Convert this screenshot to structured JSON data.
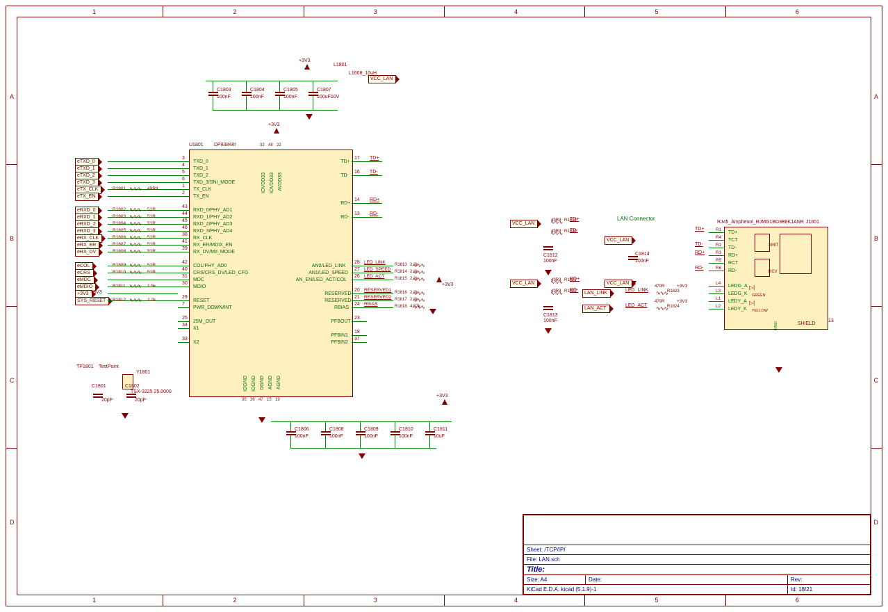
{
  "ic": {
    "ref": "U1801",
    "value": "DP83848I",
    "pins_left": [
      {
        "num": "3",
        "name": "TXD_0"
      },
      {
        "num": "4",
        "name": "TXD_1"
      },
      {
        "num": "5",
        "name": "TXD_2"
      },
      {
        "num": "6",
        "name": "TXD_3/SNI_MODE"
      },
      {
        "num": "1",
        "name": "TX_CLK"
      },
      {
        "num": "2",
        "name": "TX_EN"
      },
      {
        "num": "",
        "name": ""
      },
      {
        "num": "43",
        "name": "RXD_0/PHY_AD1"
      },
      {
        "num": "44",
        "name": "RXD_1/PHY_AD2"
      },
      {
        "num": "45",
        "name": "RXD_2/PHY_AD3"
      },
      {
        "num": "46",
        "name": "RXD_3/PHY_AD4"
      },
      {
        "num": "38",
        "name": "RX_CLK"
      },
      {
        "num": "41",
        "name": "RX_ER/MDIX_EN"
      },
      {
        "num": "39",
        "name": "RX_DV/MII_MODE"
      },
      {
        "num": "",
        "name": ""
      },
      {
        "num": "42",
        "name": "COL/PHY_AD0"
      },
      {
        "num": "40",
        "name": "CRS/CRS_DV/LED_CFG"
      },
      {
        "num": "31",
        "name": "MDC"
      },
      {
        "num": "30",
        "name": "MDIO"
      },
      {
        "num": "",
        "name": ""
      },
      {
        "num": "29",
        "name": "RESET"
      },
      {
        "num": "7",
        "name": "PWR_DOWN/INT"
      },
      {
        "num": "",
        "name": ""
      },
      {
        "num": "25",
        "name": "25M_OUT"
      },
      {
        "num": "34",
        "name": "X1"
      },
      {
        "num": "",
        "name": ""
      },
      {
        "num": "33",
        "name": "X2"
      }
    ],
    "pins_right": [
      {
        "num": "17",
        "name": "TD+"
      },
      {
        "num": "",
        "name": ""
      },
      {
        "num": "16",
        "name": "TD-"
      },
      {
        "num": "",
        "name": ""
      },
      {
        "num": "",
        "name": ""
      },
      {
        "num": "",
        "name": ""
      },
      {
        "num": "14",
        "name": "RD+"
      },
      {
        "num": "",
        "name": ""
      },
      {
        "num": "13",
        "name": "RD-"
      },
      {
        "num": "",
        "name": ""
      },
      {
        "num": "",
        "name": ""
      },
      {
        "num": "",
        "name": ""
      },
      {
        "num": "",
        "name": ""
      },
      {
        "num": "",
        "name": ""
      },
      {
        "num": "",
        "name": ""
      },
      {
        "num": "28",
        "name": "AN0/LED_LINK"
      },
      {
        "num": "27",
        "name": "AN1/LED_SPEED"
      },
      {
        "num": "26",
        "name": "AN_EN/LED_ACT/COL"
      },
      {
        "num": "",
        "name": ""
      },
      {
        "num": "20",
        "name": "RESERVED"
      },
      {
        "num": "21",
        "name": "RESERVED"
      },
      {
        "num": "24",
        "name": "RBIAS"
      },
      {
        "num": "",
        "name": ""
      },
      {
        "num": "23",
        "name": "PFBOUT"
      },
      {
        "num": "",
        "name": ""
      },
      {
        "num": "18",
        "name": "PFBIN1"
      },
      {
        "num": "37",
        "name": "PFBIN2"
      }
    ],
    "pins_top": [
      "IOVDD33",
      "IOVDD33",
      "AVDD33"
    ],
    "pins_top_num": [
      "32",
      "48",
      "22"
    ],
    "pins_bot": [
      "IOGND",
      "IOGND",
      "DGND",
      "AGND",
      "AGND"
    ],
    "pins_bot_num": [
      "35",
      "36",
      "47",
      "15",
      "19"
    ]
  },
  "ports_left": [
    "eTXD_0",
    "eTXD_1",
    "eTXD_2",
    "eTXD_3",
    "eTX_CLK",
    "eTX_EN",
    "",
    "eRXD_0",
    "eRXD_1",
    "eRXD_2",
    "eRXD_3",
    "eRX_CLK",
    "eRX_ER",
    "eRX_DV",
    "",
    "eCOL",
    "eCRS",
    "eMDC",
    "eMDIO",
    "+3V3",
    "SYS_RESET"
  ],
  "series_res_left": [
    {
      "ref": "R1801",
      "val": "49R9"
    },
    {
      "ref": "R1802",
      "val": "51R"
    },
    {
      "ref": "R1803",
      "val": "51R"
    },
    {
      "ref": "R1804",
      "val": "51R"
    },
    {
      "ref": "R1805",
      "val": "51R"
    },
    {
      "ref": "R1806",
      "val": "51R"
    },
    {
      "ref": "R1807",
      "val": "51R"
    },
    {
      "ref": "R1808",
      "val": "51R"
    },
    {
      "ref": "R1809",
      "val": "51R"
    },
    {
      "ref": "R1810",
      "val": "51R"
    },
    {
      "ref": "R1811",
      "val": "1.5k"
    },
    {
      "ref": "R1812",
      "val": "2.2k"
    }
  ],
  "top_caps": [
    {
      "ref": "C1803",
      "val": "100nF"
    },
    {
      "ref": "C1804",
      "val": "100nF"
    },
    {
      "ref": "C1805",
      "val": "100nF"
    },
    {
      "ref": "C1807",
      "val": "100uF10V"
    }
  ],
  "inductor": {
    "ref": "L1801",
    "val": "L1608_10uH"
  },
  "power_labels": {
    "v33": "+3V3",
    "vcc": "VCC_LAN"
  },
  "xtal": {
    "ref": "Y1801",
    "val": "TSX-3225 25.0000"
  },
  "testpoint": {
    "ref": "TP1801",
    "val": "TestPoint"
  },
  "xtal_caps": [
    {
      "ref": "C1801",
      "val": "20pF"
    },
    {
      "ref": "C1802",
      "val": "20pF"
    }
  ],
  "bot_caps": [
    {
      "ref": "C1806",
      "val": "100nF"
    },
    {
      "ref": "C1808",
      "val": "100nF"
    },
    {
      "ref": "C1809",
      "val": "100nF"
    },
    {
      "ref": "C1810",
      "val": "100nF"
    },
    {
      "ref": "C1811",
      "val": "10uF"
    }
  ],
  "led_nets": [
    "LED_LINK",
    "LED_SPEED",
    "LED_ACT",
    "RESERVED1",
    "RESERVED2",
    "RBIAS"
  ],
  "led_res": [
    {
      "ref": "R1813",
      "val": "2.2k"
    },
    {
      "ref": "R1814",
      "val": "2.2k"
    },
    {
      "ref": "R1815",
      "val": "2.2k"
    },
    {
      "ref": "R1816",
      "val": "2.2k"
    },
    {
      "ref": "R1817",
      "val": "2.2k"
    },
    {
      "ref": "R1818",
      "val": "4.87k"
    }
  ],
  "td_nets": [
    "TD+",
    "TD-",
    "RD+",
    "RD-"
  ],
  "mid_block": {
    "td_res": [
      {
        "ref": "R1819",
        "val": "49R9"
      },
      {
        "ref": "R1820",
        "val": "49R9"
      },
      {
        "ref": "R1821",
        "val": "49R9"
      },
      {
        "ref": "R1822",
        "val": "49R9"
      }
    ],
    "caps": [
      {
        "ref": "C1812",
        "val": "100nF"
      },
      {
        "ref": "C1813",
        "val": "100nF"
      }
    ]
  },
  "rj45": {
    "ref": "J1801",
    "value": "RJ45_Amphenol_RJMG1BD3B8K1ANR",
    "title": "LAN Connector",
    "pins_left": [
      {
        "num": "R1",
        "name": "TD+"
      },
      {
        "num": "R4",
        "name": "TCT"
      },
      {
        "num": "R2",
        "name": "TD-"
      },
      {
        "num": "R3",
        "name": "RD+"
      },
      {
        "num": "R5",
        "name": "RCT"
      },
      {
        "num": "R6",
        "name": "RD-"
      },
      {
        "num": "",
        "name": ""
      },
      {
        "num": "L4",
        "name": "LEDG_A"
      },
      {
        "num": "L3",
        "name": "LEDG_K"
      },
      {
        "num": "L1",
        "name": "LEDY_A"
      },
      {
        "num": "L2",
        "name": "LEDY_K"
      }
    ],
    "shield": {
      "num": "13",
      "name": "SHIELD"
    },
    "annot": [
      "XMIT",
      "RCV",
      "GREEN",
      "YELLOW"
    ]
  },
  "rj45_left": {
    "cap": {
      "ref": "C1814",
      "val": "100nF"
    },
    "res": [
      {
        "ref": "R1823",
        "val": "470R"
      },
      {
        "ref": "R1824",
        "val": "470R"
      }
    ],
    "ports": [
      "VCC_LAN",
      "VCC_LAN",
      "LAN_LINK",
      "LAN_ACT"
    ],
    "nets": [
      "TD+",
      "TD-",
      "RD+",
      "RD-",
      "LED_LINK",
      "LED_ACT",
      "+3V3"
    ]
  },
  "title_block": {
    "sheet": "Sheet: /TCP/IP/",
    "file": "File: LAN.sch",
    "title_lbl": "Title:",
    "size_lbl": "Size: A4",
    "date_lbl": "Date:",
    "rev_lbl": "Rev:",
    "tool": "KiCad E.D.A.  kicad (5.1.9)-1",
    "id": "Id: 18/21"
  },
  "ruler_cols": [
    "1",
    "2",
    "3",
    "4",
    "5",
    "6"
  ],
  "ruler_rows": [
    "A",
    "B",
    "C",
    "D"
  ]
}
